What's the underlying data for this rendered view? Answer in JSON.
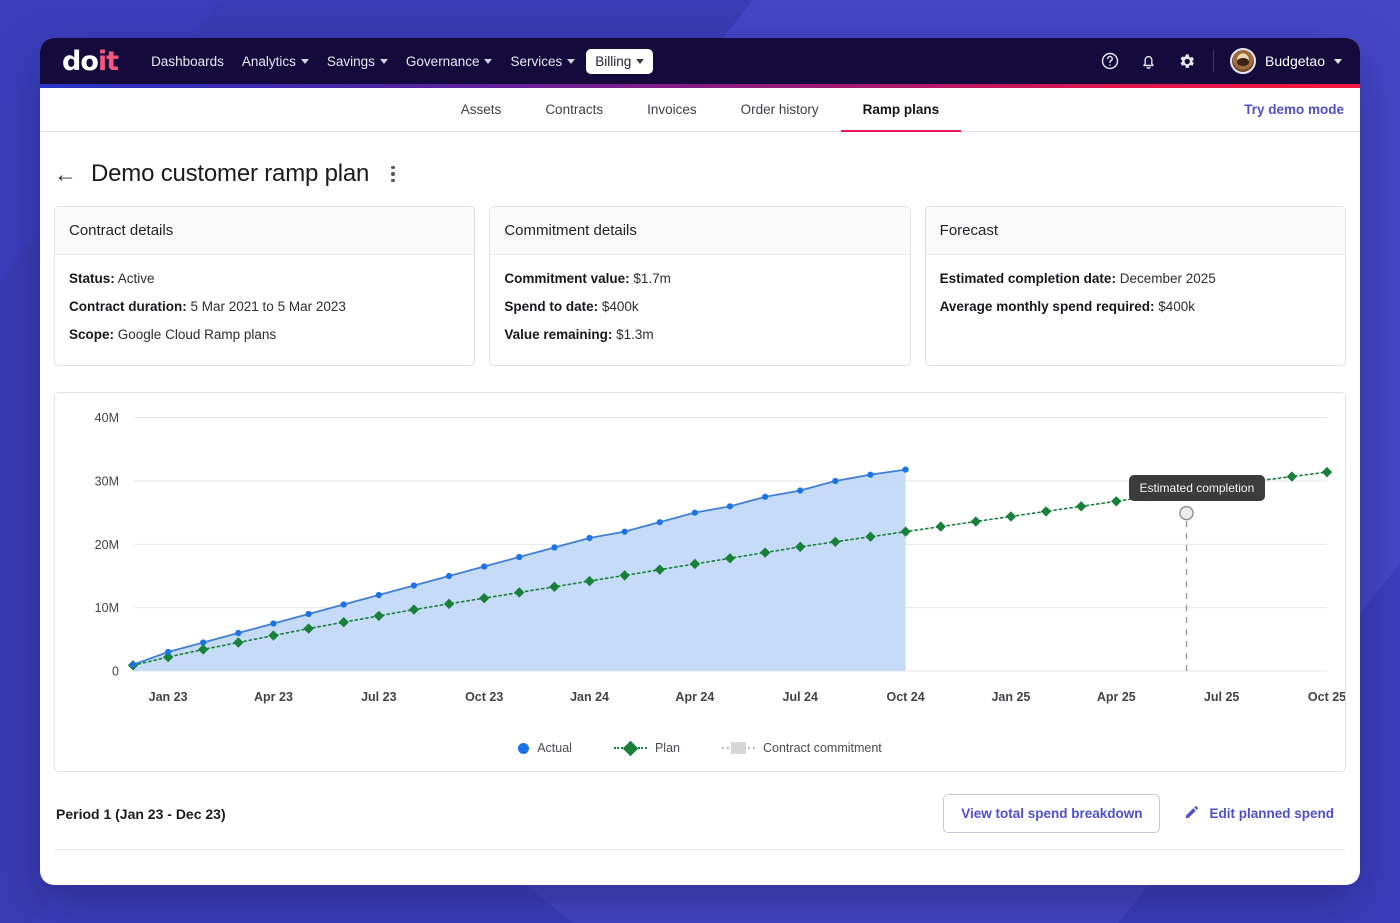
{
  "topnav": {
    "logo_do": "do",
    "logo_it": "it",
    "items": [
      {
        "label": "Dashboards",
        "has_caret": false,
        "active": false
      },
      {
        "label": "Analytics",
        "has_caret": true,
        "active": false
      },
      {
        "label": "Savings",
        "has_caret": true,
        "active": false
      },
      {
        "label": "Governance",
        "has_caret": true,
        "active": false
      },
      {
        "label": "Services",
        "has_caret": true,
        "active": false
      },
      {
        "label": "Billing",
        "has_caret": true,
        "active": true
      }
    ],
    "icons": [
      "help-circle-icon",
      "bell-icon",
      "gear-icon"
    ],
    "user_name": "Budgetao"
  },
  "subnav": {
    "tabs": [
      {
        "label": "Assets",
        "active": false
      },
      {
        "label": "Contracts",
        "active": false
      },
      {
        "label": "Invoices",
        "active": false
      },
      {
        "label": "Order history",
        "active": false
      },
      {
        "label": "Ramp plans",
        "active": true
      }
    ],
    "demo_link": "Try demo mode"
  },
  "page": {
    "title": "Demo customer ramp plan",
    "back_icon": "←"
  },
  "cards": [
    {
      "title": "Contract details",
      "rows": [
        {
          "key": "Status:",
          "value": "Active"
        },
        {
          "key": "Contract duration:",
          "value": "5 Mar 2021 to 5 Mar 2023"
        },
        {
          "key": "Scope:",
          "value": "Google Cloud Ramp plans"
        }
      ]
    },
    {
      "title": "Commitment details",
      "rows": [
        {
          "key": "Commitment value:",
          "value": "$1.7m"
        },
        {
          "key": "Spend to date:",
          "value": "$400k"
        },
        {
          "key": "Value remaining:",
          "value": "$1.3m"
        }
      ]
    },
    {
      "title": "Forecast",
      "rows": [
        {
          "key": "Estimated completion date:",
          "value": "December 2025"
        },
        {
          "key": "Average monthly spend required:",
          "value": "$400k"
        }
      ]
    }
  ],
  "chart_data": {
    "type": "line",
    "title": "",
    "xlabel": "",
    "ylabel": "",
    "ylim": [
      0,
      42000000
    ],
    "y_ticks": [
      0,
      10000000,
      20000000,
      30000000,
      40000000
    ],
    "y_tick_labels": [
      "0",
      "10M",
      "20M",
      "30M",
      "40M"
    ],
    "grid": true,
    "legend_position": "bottom",
    "x_tick_labels": [
      "Jan 23",
      "Apr 23",
      "Jul 23",
      "Oct 23",
      "Jan 24",
      "Apr 24",
      "Jul 24",
      "Oct 24",
      "Jan 25",
      "Apr 25",
      "Jul 25",
      "Oct 25"
    ],
    "x_months": [
      "Dec 22",
      "Jan 23",
      "Feb 23",
      "Mar 23",
      "Apr 23",
      "May 23",
      "Jun 23",
      "Jul 23",
      "Aug 23",
      "Sep 23",
      "Oct 23",
      "Nov 23",
      "Dec 23",
      "Jan 24",
      "Feb 24",
      "Mar 24",
      "Apr 24",
      "May 24",
      "Jun 24",
      "Jul 24",
      "Aug 24",
      "Sep 24",
      "Oct 24",
      "Nov 24",
      "Dec 24",
      "Jan 25",
      "Feb 25",
      "Mar 25",
      "Apr 25",
      "May 25",
      "Jun 25",
      "Jul 25",
      "Aug 25",
      "Sep 25",
      "Oct 25"
    ],
    "series": [
      {
        "name": "Actual",
        "color": "#1a73e8",
        "marker": "circle",
        "line_style": "solid",
        "filled_area": true,
        "area_color": "#c3d9f8",
        "values": [
          1000000,
          3000000,
          4500000,
          6000000,
          7500000,
          9000000,
          10500000,
          12000000,
          13500000,
          15000000,
          16500000,
          18000000,
          19500000,
          21000000,
          22000000,
          23500000,
          25000000,
          26000000,
          27500000,
          28500000,
          30000000,
          31000000,
          31800000
        ]
      },
      {
        "name": "Plan",
        "color": "#188038",
        "marker": "diamond",
        "line_style": "dotted",
        "filled_area": false,
        "values": [
          900000,
          2200000,
          3400000,
          4500000,
          5600000,
          6700000,
          7700000,
          8700000,
          9700000,
          10600000,
          11500000,
          12400000,
          13300000,
          14200000,
          15100000,
          16000000,
          16900000,
          17800000,
          18700000,
          19600000,
          20400000,
          21200000,
          22000000,
          22800000,
          23600000,
          24400000,
          25200000,
          26000000,
          26800000,
          27600000,
          28400000,
          29200000,
          30000000,
          30700000,
          31400000
        ]
      },
      {
        "name": "Contract commitment",
        "color": "#d5d5d8",
        "marker": "square",
        "line_style": "dotted",
        "filled_area": false,
        "values": []
      }
    ],
    "annotations": [
      {
        "label": "Estimated completion",
        "x": "Jun 25",
        "marker": "open-circle",
        "vertical_line": "dashed"
      }
    ]
  },
  "legend": [
    {
      "label": "Actual",
      "icon": "circle-marker",
      "color": "#1a73e8"
    },
    {
      "label": "Plan",
      "icon": "diamond-marker",
      "color": "#188038"
    },
    {
      "label": "Contract commitment",
      "icon": "square-marker",
      "color": "#d5d5d8"
    }
  ],
  "footer": {
    "period_label": "Period 1 (Jan 23 - Dec 23)",
    "view_breakdown_button": "View total spend breakdown",
    "edit_spend_button": "Edit planned spend"
  }
}
